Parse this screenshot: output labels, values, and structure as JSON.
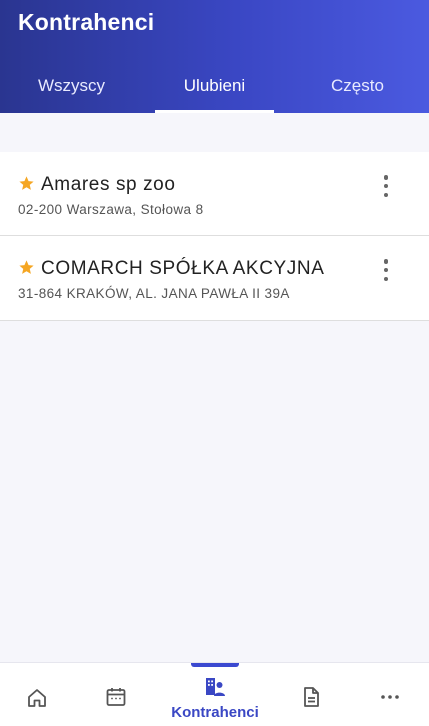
{
  "header": {
    "title": "Kontrahenci"
  },
  "tabs": [
    {
      "label": "Wszyscy",
      "active": false
    },
    {
      "label": "Ulubieni",
      "active": true
    },
    {
      "label": "Często",
      "active": false
    }
  ],
  "contractors": [
    {
      "name": "Amares sp zoo",
      "address": "02-200 Warszawa, Stołowa 8",
      "favorite": true
    },
    {
      "name": "COMARCH SPÓŁKA AKCYJNA",
      "address": "31-864 KRAKÓW, AL. JANA PAWŁA II 39A",
      "favorite": true
    }
  ],
  "bottom_nav": {
    "items": [
      {
        "icon": "home-icon",
        "active": false
      },
      {
        "icon": "calendar-icon",
        "active": false
      },
      {
        "icon": "contractors-icon",
        "label": "Kontrahenci",
        "active": true
      },
      {
        "icon": "document-icon",
        "active": false
      },
      {
        "icon": "more-horizontal-icon",
        "active": false
      }
    ]
  },
  "colors": {
    "header_start": "#2a3590",
    "header_end": "#4b5ae0",
    "accent": "#3a47c4",
    "star": "#f5a623"
  }
}
